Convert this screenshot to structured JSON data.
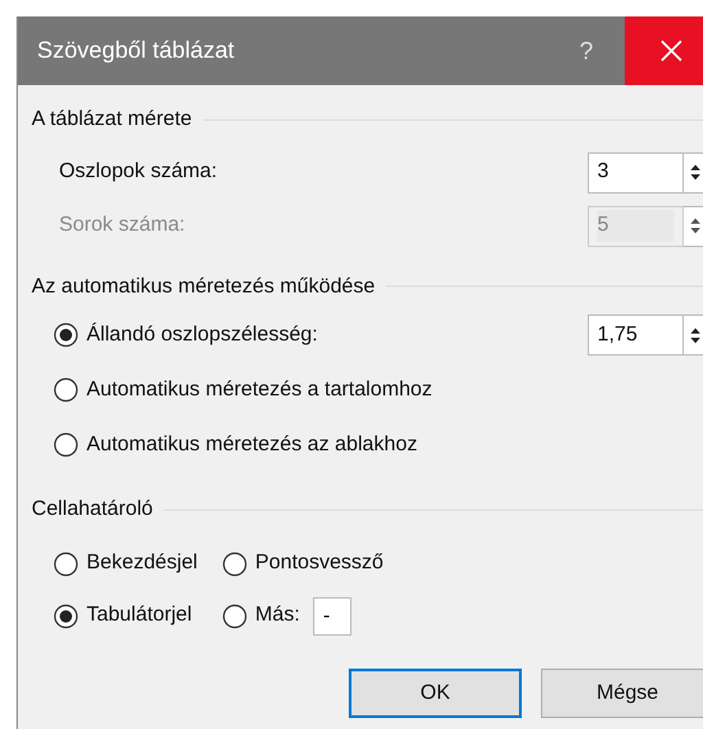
{
  "window": {
    "title": "Szövegből táblázat",
    "help": "?"
  },
  "size_group": {
    "title": "A táblázat mérete",
    "fields": [
      {
        "label": "Oszlopok száma:",
        "value": "3",
        "disabled": false
      },
      {
        "label": "Sorok száma:",
        "value": "5",
        "disabled": true
      }
    ]
  },
  "autofit_group": {
    "title": "Az automatikus méretezés működése",
    "options": [
      {
        "label": "Állandó oszlopszélesség:",
        "selected": true,
        "value": "1,75"
      },
      {
        "label": "Automatikus méretezés a tartalomhoz",
        "selected": false
      },
      {
        "label": "Automatikus méretezés az ablakhoz",
        "selected": false
      }
    ]
  },
  "separator_group": {
    "title": "Cellahatároló",
    "options": [
      {
        "label": "Bekezdésjel",
        "selected": false
      },
      {
        "label": "Pontosvessző",
        "selected": false
      },
      {
        "label": "Tabulátorjel",
        "selected": true
      },
      {
        "label": "Más:",
        "selected": false,
        "kind": "other"
      }
    ],
    "other_character": "-"
  },
  "buttons": [
    {
      "label": "OK",
      "default": true
    },
    {
      "label": "Mégse",
      "default": false
    }
  ]
}
